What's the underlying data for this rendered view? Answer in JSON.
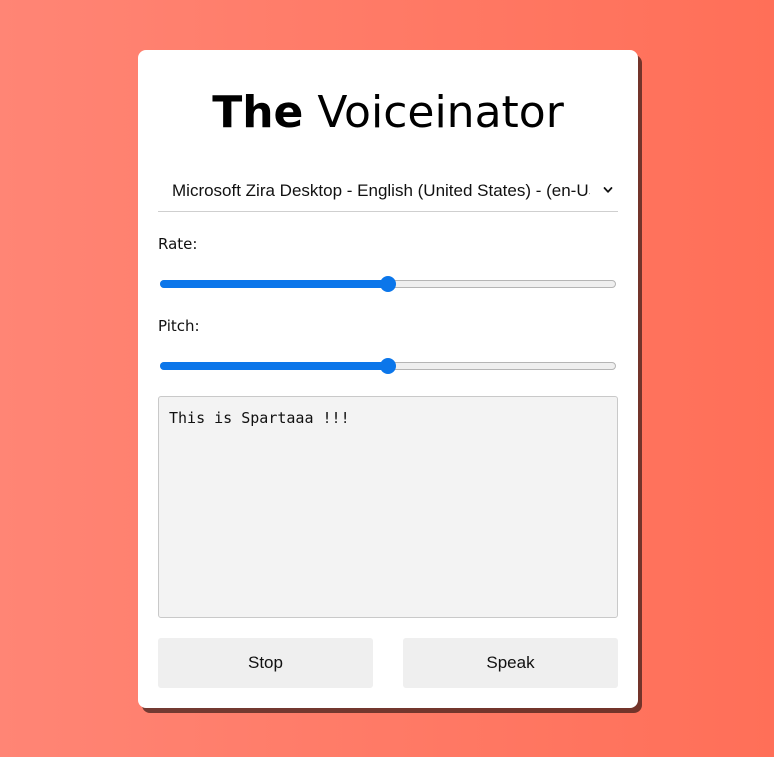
{
  "app": {
    "title_bold": "The",
    "title_rest": " Voiceinator"
  },
  "voice_select": {
    "value": "Microsoft Zira Desktop - English (United States) - (en-US)",
    "icon": "chevron-down-icon"
  },
  "controls": {
    "rate_label": "Rate:",
    "rate_value_fraction": 0.5,
    "pitch_label": "Pitch:",
    "pitch_value_fraction": 0.5
  },
  "text_area": {
    "value": "This is Spartaaa !!!"
  },
  "buttons": {
    "stop_label": "Stop",
    "speak_label": "Speak"
  },
  "colors": {
    "accent": "#0b76ea",
    "background": "#ff7a66"
  }
}
